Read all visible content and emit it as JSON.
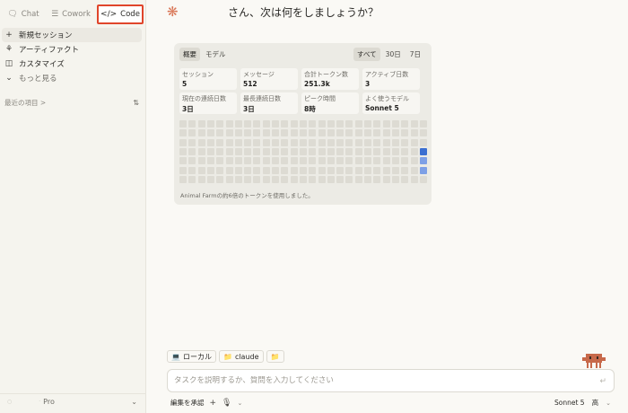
{
  "sidebar": {
    "mode_tabs": [
      {
        "label": "Chat",
        "icon": "chat-bubble-icon"
      },
      {
        "label": "Cowork",
        "icon": "cowork-icon"
      },
      {
        "label": "Code",
        "icon": "code-brackets-icon"
      }
    ],
    "nav": [
      {
        "label": "新規セッション",
        "icon": "plus-icon"
      },
      {
        "label": "アーティファクト",
        "icon": "artifacts-icon"
      },
      {
        "label": "カスタマイズ",
        "icon": "briefcase-icon"
      },
      {
        "label": "もっと見る",
        "icon": "chevron-down-icon"
      }
    ],
    "recents_label": "最近の項目 >",
    "account_plan": "Pro"
  },
  "greeting": "さん、次は何をしましょうか？",
  "stats": {
    "tabs": [
      "概要",
      "モデル"
    ],
    "ranges": [
      "すべて",
      "30日",
      "7日"
    ],
    "cards": [
      {
        "label": "セッション",
        "value": "5"
      },
      {
        "label": "メッセージ",
        "value": "512"
      },
      {
        "label": "合計トークン数",
        "value": "251.3k"
      },
      {
        "label": "アクティブ日数",
        "value": "3"
      },
      {
        "label": "現在の連続日数",
        "value": "3日"
      },
      {
        "label": "最長連続日数",
        "value": "3日"
      },
      {
        "label": "ピーク時間",
        "value": "8時"
      },
      {
        "label": "よく使うモデル",
        "value": "Sonnet 5"
      }
    ],
    "footnote": "Animal Farmの約6倍のトークンを使用しました。",
    "activity_colors": {
      "empty": "#dddbd3",
      "high": "#3b6fd1",
      "low": "#7ea0e6"
    }
  },
  "chips": [
    {
      "label": "ローカル",
      "icon": "laptop-icon"
    },
    {
      "label": "claude",
      "icon": "folder-icon"
    },
    {
      "label": "",
      "icon": "folder-icon"
    }
  ],
  "input": {
    "placeholder": "タスクを説明するか、質問を入力してください"
  },
  "toolbar": {
    "approve_label": "編集を承認",
    "model": "Sonnet 5",
    "effort": "高"
  },
  "colors": {
    "accent": "#d97757",
    "highlight_border": "#e0452b"
  }
}
